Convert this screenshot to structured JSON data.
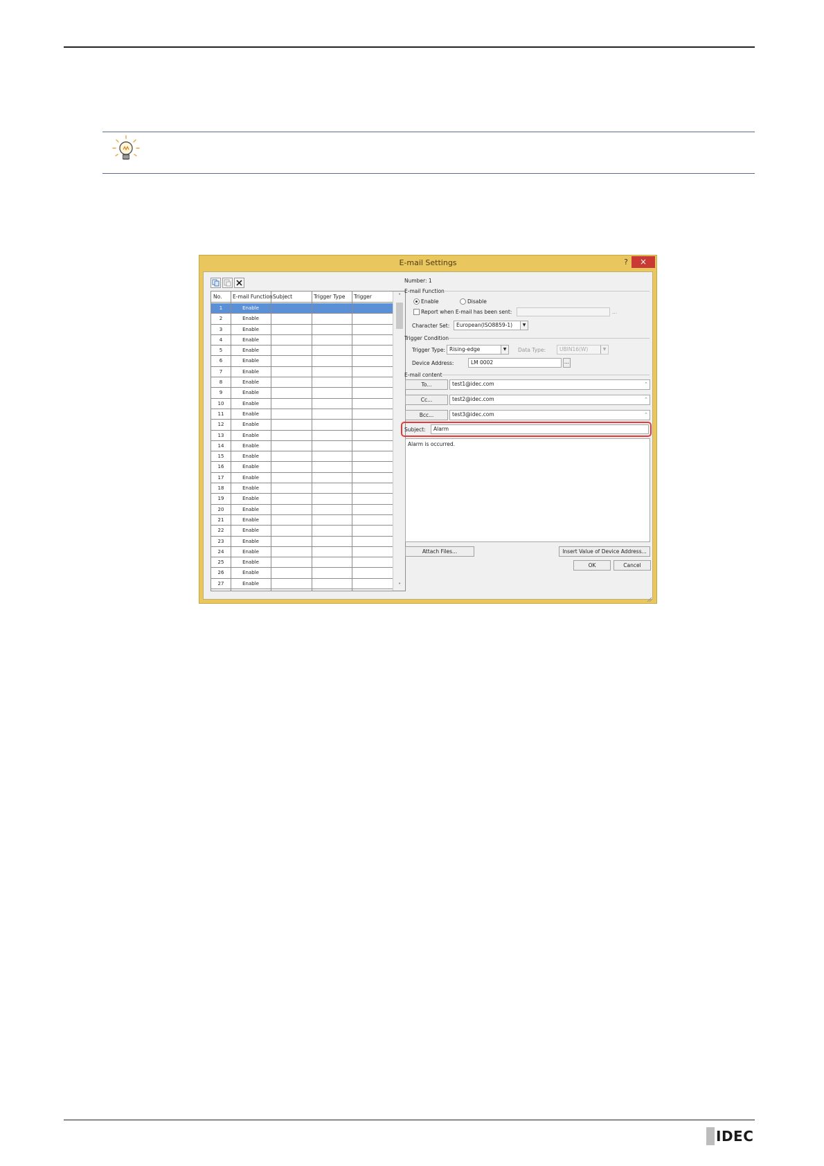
{
  "dialog": {
    "title": "E-mail Settings",
    "help_label": "?",
    "close_label": "×",
    "table": {
      "headers": [
        "No.",
        "E-mail Function",
        "Subject",
        "Trigger Type",
        "Trigger"
      ],
      "rows": [
        {
          "no": "1",
          "fn": "Enable"
        },
        {
          "no": "2",
          "fn": "Enable"
        },
        {
          "no": "3",
          "fn": "Enable"
        },
        {
          "no": "4",
          "fn": "Enable"
        },
        {
          "no": "5",
          "fn": "Enable"
        },
        {
          "no": "6",
          "fn": "Enable"
        },
        {
          "no": "7",
          "fn": "Enable"
        },
        {
          "no": "8",
          "fn": "Enable"
        },
        {
          "no": "9",
          "fn": "Enable"
        },
        {
          "no": "10",
          "fn": "Enable"
        },
        {
          "no": "11",
          "fn": "Enable"
        },
        {
          "no": "12",
          "fn": "Enable"
        },
        {
          "no": "13",
          "fn": "Enable"
        },
        {
          "no": "14",
          "fn": "Enable"
        },
        {
          "no": "15",
          "fn": "Enable"
        },
        {
          "no": "16",
          "fn": "Enable"
        },
        {
          "no": "17",
          "fn": "Enable"
        },
        {
          "no": "18",
          "fn": "Enable"
        },
        {
          "no": "19",
          "fn": "Enable"
        },
        {
          "no": "20",
          "fn": "Enable"
        },
        {
          "no": "21",
          "fn": "Enable"
        },
        {
          "no": "22",
          "fn": "Enable"
        },
        {
          "no": "23",
          "fn": "Enable"
        },
        {
          "no": "24",
          "fn": "Enable"
        },
        {
          "no": "25",
          "fn": "Enable"
        },
        {
          "no": "26",
          "fn": "Enable"
        },
        {
          "no": "27",
          "fn": "Enable"
        }
      ],
      "selected_row": "1",
      "scroll_up": "˄",
      "scroll_down": "˅"
    },
    "number_label": "Number: 1",
    "email_function": {
      "group_label": "E-mail Function",
      "enable_label": "Enable",
      "disable_label": "Disable",
      "selected": "Enable",
      "report_label": "Report when E-mail has been sent:",
      "report_value": "",
      "report_browse": "...",
      "charset_label": "Character Set:",
      "charset_value": "European(ISO8859-1)"
    },
    "trigger": {
      "group_label": "Trigger Condition",
      "type_label": "Trigger Type:",
      "type_value": "Rising-edge",
      "data_type_label": "Data Type:",
      "data_type_value": "UBIN16(W)",
      "device_label": "Device Address:",
      "device_value": "LM 0002",
      "device_browse": "..."
    },
    "content": {
      "group_label": "E-mail content",
      "to_label": "To...",
      "to_value": "test1@idec.com",
      "cc_label": "Cc...",
      "cc_value": "test2@idec.com",
      "bcc_label": "Bcc...",
      "bcc_value": "test3@idec.com",
      "subject_label": "Subject:",
      "subject_value": "Alarm",
      "body_value": "Alarm is occurred.",
      "attach_label": "Attach Files...",
      "insert_label": "Insert Value of Device Address...",
      "ok_label": "OK",
      "cancel_label": "Cancel"
    },
    "dd_arrow": "▼",
    "spin": "⌃"
  },
  "footer": {
    "logo": "IDEC"
  }
}
